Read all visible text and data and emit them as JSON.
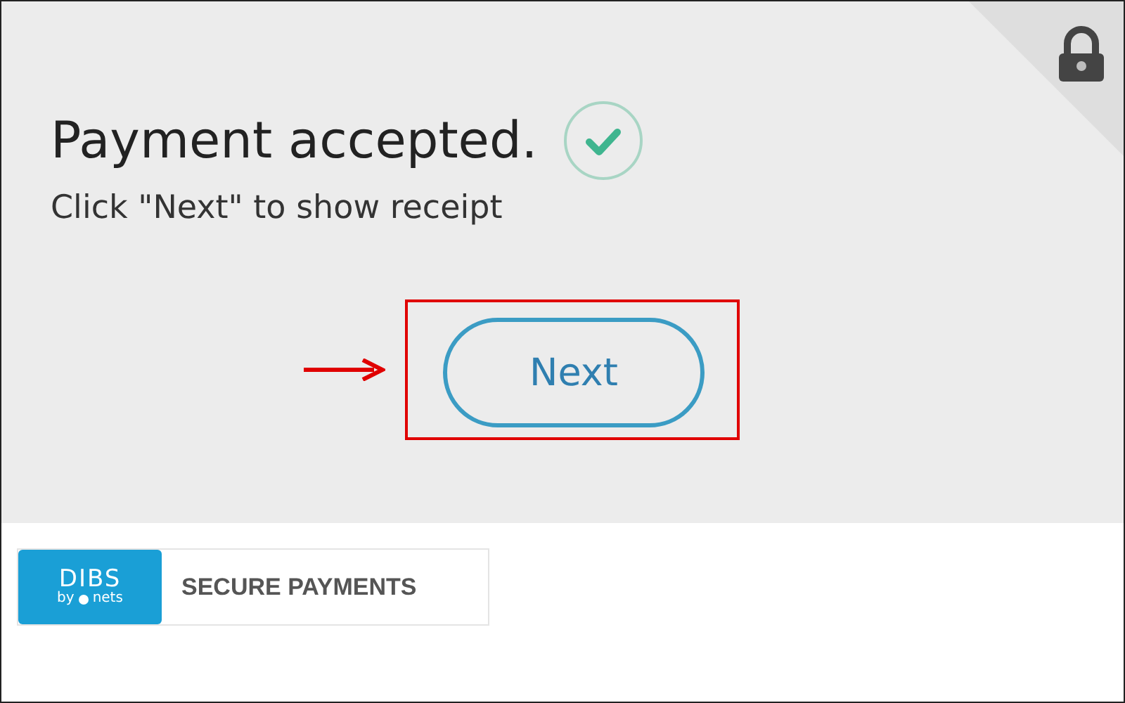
{
  "status": {
    "heading": "Payment accepted.",
    "instruction": "Click \"Next\" to show receipt"
  },
  "next_button": {
    "label": "Next",
    "highlighted": true
  },
  "footer": {
    "logo": {
      "brand": "DIBS",
      "by": "by",
      "partner": "nets"
    },
    "badge_text": "SECURE PAYMENTS"
  }
}
